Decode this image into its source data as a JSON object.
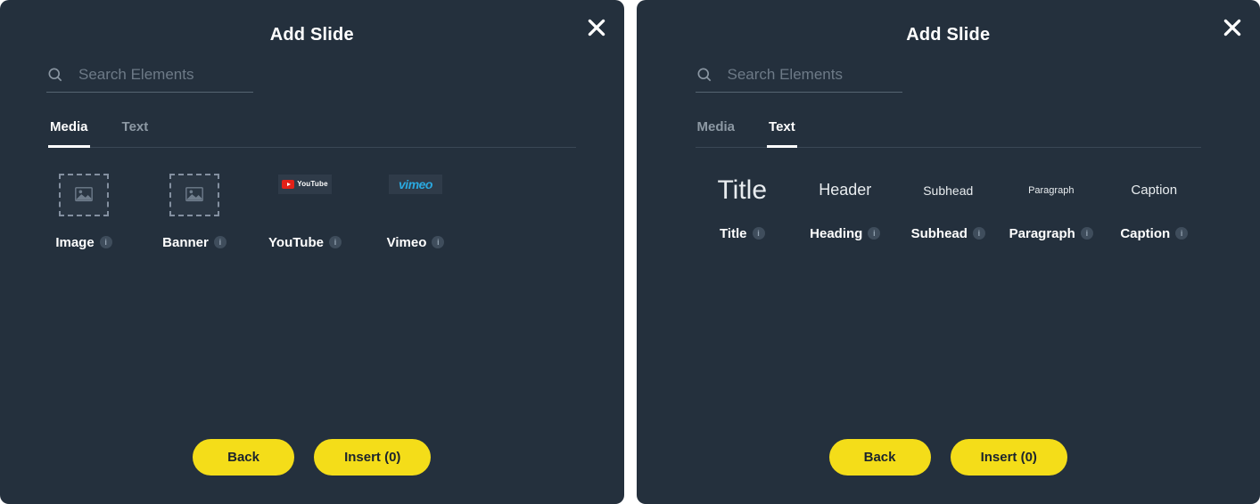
{
  "panels": [
    {
      "title": "Add Slide",
      "close_aria": "Close",
      "search": {
        "placeholder": "Search Elements",
        "value": ""
      },
      "tabs": [
        {
          "label": "Media",
          "active": true,
          "key": "media"
        },
        {
          "label": "Text",
          "active": false,
          "key": "text"
        }
      ],
      "media_tiles": [
        {
          "label": "Image",
          "kind": "image",
          "info": "i"
        },
        {
          "label": "Banner",
          "kind": "banner",
          "info": "i"
        },
        {
          "label": "YouTube",
          "kind": "youtube",
          "info": "i",
          "brand_text": "YouTube"
        },
        {
          "label": "Vimeo",
          "kind": "vimeo",
          "info": "i",
          "brand_text": "vimeo"
        }
      ],
      "buttons": {
        "back": "Back",
        "insert": "Insert (0)",
        "insert_count": 0
      }
    },
    {
      "title": "Add Slide",
      "close_aria": "Close",
      "search": {
        "placeholder": "Search Elements",
        "value": ""
      },
      "tabs": [
        {
          "label": "Media",
          "active": false,
          "key": "media"
        },
        {
          "label": "Text",
          "active": true,
          "key": "text"
        }
      ],
      "text_tiles": [
        {
          "sample": "Title",
          "style": "title",
          "label": "Title",
          "info": "i"
        },
        {
          "sample": "Header",
          "style": "header",
          "label": "Heading",
          "info": "i"
        },
        {
          "sample": "Subhead",
          "style": "subhead",
          "label": "Subhead",
          "info": "i"
        },
        {
          "sample": "Paragraph",
          "style": "para",
          "label": "Paragraph",
          "info": "i"
        },
        {
          "sample": "Caption",
          "style": "caption",
          "label": "Caption",
          "info": "i"
        }
      ],
      "buttons": {
        "back": "Back",
        "insert": "Insert (0)",
        "insert_count": 0
      }
    }
  ],
  "colors": {
    "accent": "#f4dd19",
    "panel_bg": "#24303d",
    "youtube_red": "#e32118",
    "vimeo_blue": "#2aa9e0"
  }
}
